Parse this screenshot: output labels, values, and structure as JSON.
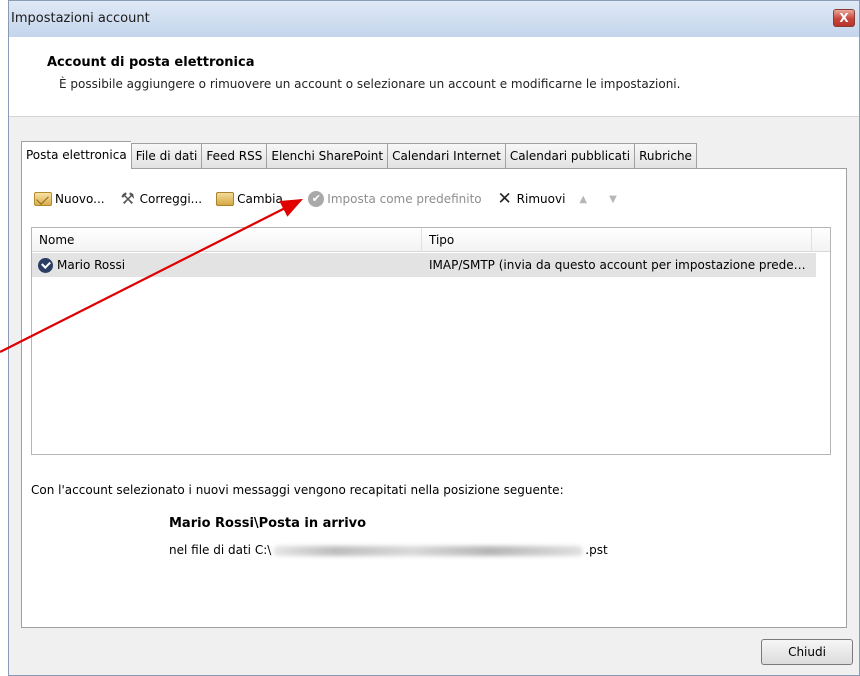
{
  "window": {
    "title": "Impostazioni account",
    "close_glyph": "X"
  },
  "header": {
    "title": "Account di posta elettronica",
    "subtitle": "È possibile aggiungere o rimuovere un account o selezionare un account e modificarne le impostazioni."
  },
  "tabs": [
    {
      "label": "Posta elettronica",
      "active": true
    },
    {
      "label": "File di dati"
    },
    {
      "label": "Feed RSS"
    },
    {
      "label": "Elenchi SharePoint"
    },
    {
      "label": "Calendari Internet"
    },
    {
      "label": "Calendari pubblicati"
    },
    {
      "label": "Rubriche"
    }
  ],
  "toolbar": {
    "new_label": "Nuovo...",
    "repair_label": "Correggi...",
    "change_label": "Cambia...",
    "default_label": "Imposta come predefinito",
    "remove_label": "Rimuovi",
    "up_icon": "arrow-up-icon",
    "down_icon": "arrow-down-icon"
  },
  "list": {
    "columns": {
      "name": "Nome",
      "type": "Tipo"
    },
    "rows": [
      {
        "name": "Mario Rossi",
        "type": "IMAP/SMTP (invia da questo account per impostazione predefinita)",
        "selected": true
      }
    ]
  },
  "delivery": {
    "text": "Con l'account selezionato i nuovi messaggi vengono recapitati nella posizione seguente:",
    "folder": "Mario Rossi\\Posta in arrivo",
    "file_prefix": "nel file di dati C:\\",
    "file_suffix": ".pst"
  },
  "footer": {
    "close_label": "Chiudi"
  },
  "colors": {
    "annotation_arrow": "#e00000",
    "selected_row": "#e3e3e3"
  }
}
